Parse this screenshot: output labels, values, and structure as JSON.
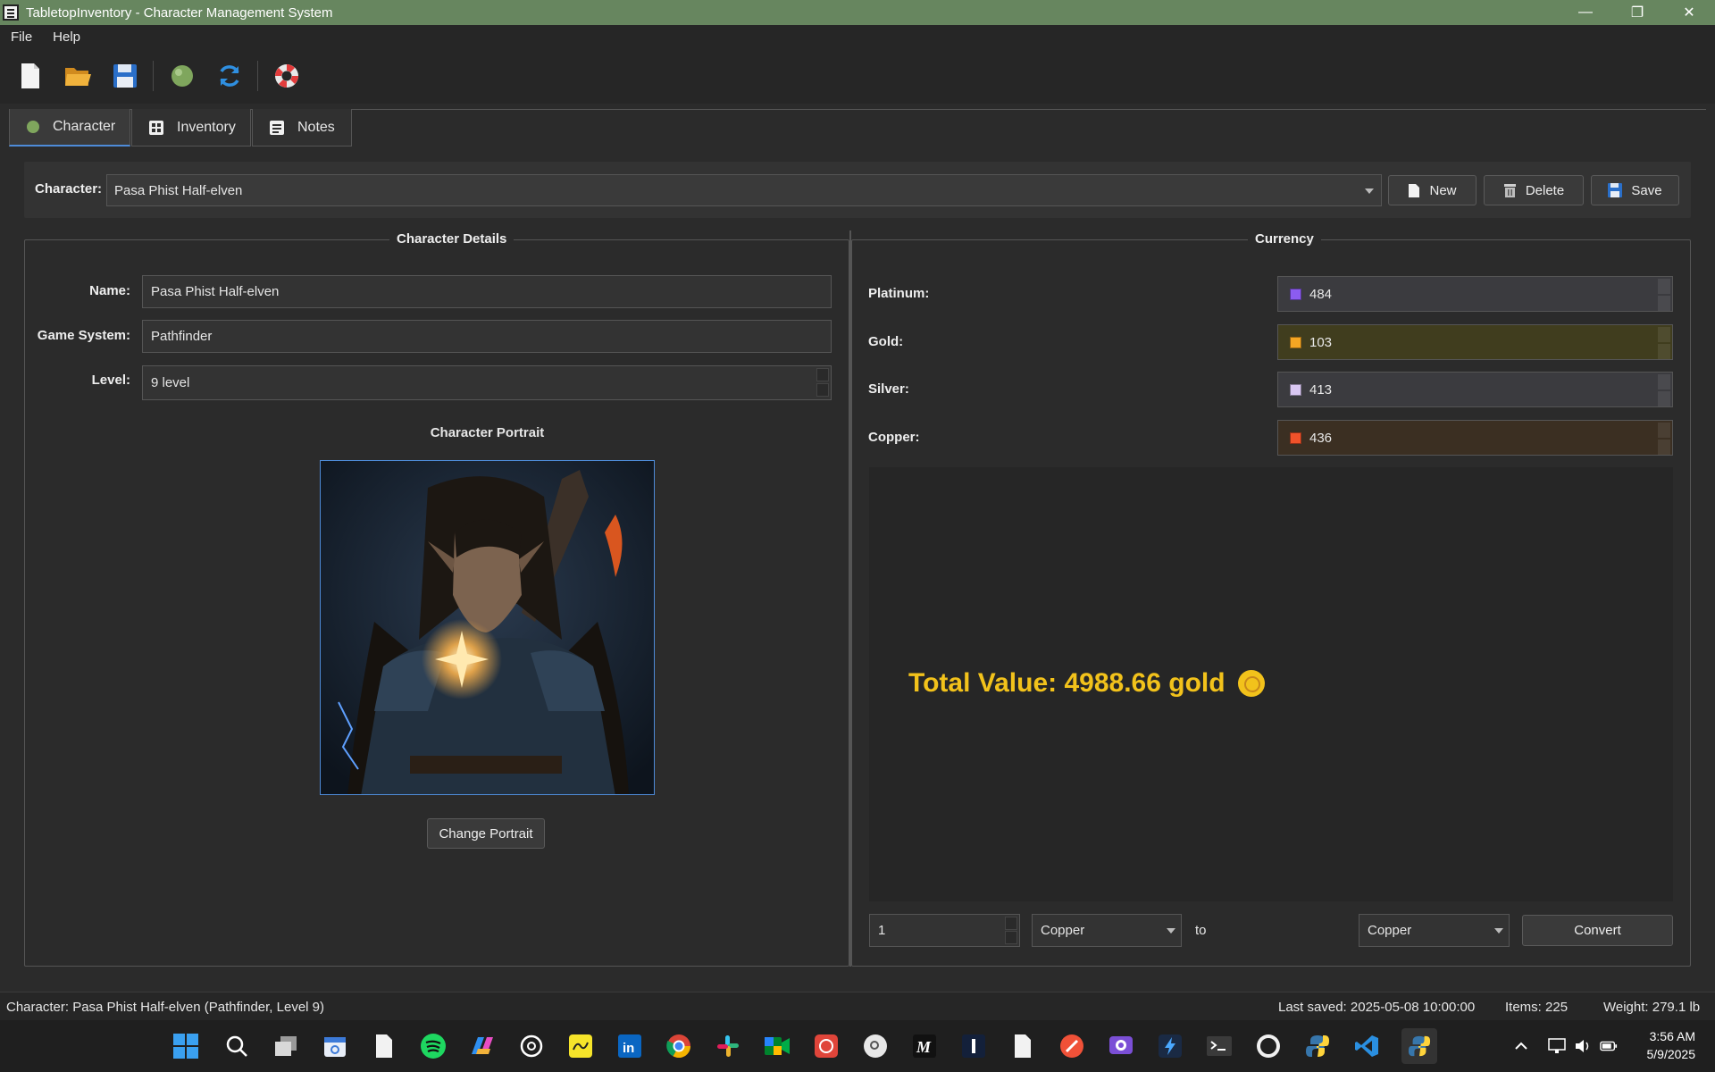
{
  "window": {
    "title": "TabletopInventory - Character Management System",
    "controls": {
      "minimize": "—",
      "maximize": "❐",
      "close": "✕"
    }
  },
  "menu": [
    "File",
    "Help"
  ],
  "toolbar": {
    "icons": [
      "new-file-icon",
      "open-folder-icon",
      "save-disk-icon",
      "green-orb-icon",
      "refresh-icon",
      "help-lifebuoy-icon"
    ]
  },
  "tabs": [
    {
      "label": "Character",
      "icon": "green-orb-icon",
      "active": true
    },
    {
      "label": "Inventory",
      "icon": "grid-icon",
      "active": false
    },
    {
      "label": "Notes",
      "icon": "notes-icon",
      "active": false
    }
  ],
  "character_bar": {
    "label": "Character:",
    "selected": "Pasa Phist Half-elven",
    "buttons": {
      "new": "New",
      "delete": "Delete",
      "save": "Save"
    }
  },
  "details": {
    "group_title": "Character Details",
    "name_label": "Name:",
    "name_value": "Pasa Phist Half-elven",
    "system_label": "Game System:",
    "system_value": "Pathfinder",
    "level_label": "Level:",
    "level_value": "9 level",
    "portrait_title": "Character Portrait",
    "change_portrait": "Change Portrait"
  },
  "currency": {
    "group_title": "Currency",
    "platinum": {
      "label": "Platinum:",
      "value": "484",
      "swatch": "#8c5cf0",
      "bg": "#3b3b3f"
    },
    "gold": {
      "label": "Gold:",
      "value": "103",
      "swatch": "#f5a623",
      "bg": "#403d1e"
    },
    "silver": {
      "label": "Silver:",
      "value": "413",
      "swatch": "#d9c7f2",
      "bg": "#3b3b3f"
    },
    "copper": {
      "label": "Copper:",
      "value": "436",
      "swatch": "#f0522a",
      "bg": "#3b2f22"
    },
    "total": "Total Value: 4988.66 gold",
    "converter": {
      "amount": "1",
      "from": "Copper",
      "to_label": "to",
      "to": "Copper",
      "convert": "Convert"
    }
  },
  "status": {
    "character": "Character: Pasa Phist Half-elven (Pathfinder, Level 9)",
    "last_saved": "Last saved: 2025-05-08 10:00:00",
    "items": "Items: 225",
    "weight": "Weight: 279.1 lb"
  },
  "taskbar": {
    "time": "3:56 AM",
    "date": "5/9/2025",
    "apps": [
      "windows-start-icon",
      "search-icon",
      "task-view-icon",
      "calendar-icon",
      "file-icon",
      "spotify-icon",
      "copilot-icon",
      "chatgpt-icon",
      "sketch-icon",
      "linkedin-icon",
      "chrome-icon",
      "slack-icon",
      "meet-icon",
      "app-red-icon",
      "lens-icon",
      "m-icon",
      "i-icon",
      "document-icon",
      "swift-icon",
      "github-desktop-icon",
      "bolt-icon",
      "terminal-icon",
      "github-icon",
      "python-icon",
      "vscode-icon",
      "python-app-icon"
    ]
  },
  "colors": {
    "accent": "#4e8bd8",
    "titlebar": "#67865f",
    "total_text": "#f2c21b"
  }
}
